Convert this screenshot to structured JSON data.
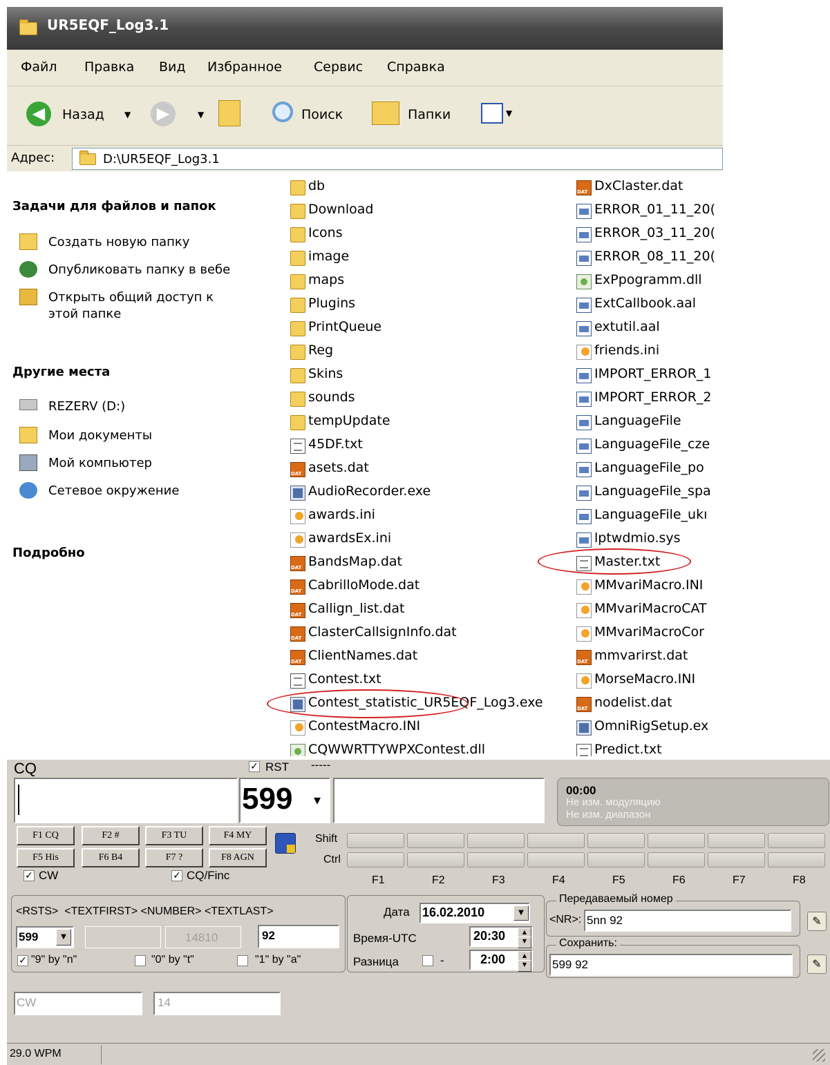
{
  "explorer": {
    "title": "UR5EQF_Log3.1",
    "menu": [
      "Файл",
      "Правка",
      "Вид",
      "Избранное",
      "Сервис",
      "Справка"
    ],
    "toolbar": {
      "back": "Назад",
      "search": "Поиск",
      "folders": "Папки"
    },
    "address": {
      "label": "Адрес:",
      "path": "D:\\UR5EQF_Log3.1"
    },
    "tasks": {
      "heading": "Задачи для файлов и папок",
      "items": [
        "Создать новую папку",
        "Опубликовать папку в вебе",
        "Открыть общий доступ к",
        "этой папке"
      ]
    },
    "places": {
      "heading": "Другие места",
      "items": [
        "REZERV (D:)",
        "Мои документы",
        "Мой компьютер",
        "Сетевое окружение"
      ]
    },
    "details": {
      "heading": "Подробно"
    },
    "files_col1": [
      {
        "name": "db",
        "type": "folder"
      },
      {
        "name": "Download",
        "type": "folder"
      },
      {
        "name": "Icons",
        "type": "folder"
      },
      {
        "name": "image",
        "type": "folder"
      },
      {
        "name": "maps",
        "type": "folder"
      },
      {
        "name": "Plugins",
        "type": "folder"
      },
      {
        "name": "PrintQueue",
        "type": "folder"
      },
      {
        "name": "Reg",
        "type": "folder"
      },
      {
        "name": "Skins",
        "type": "folder"
      },
      {
        "name": "sounds",
        "type": "folder"
      },
      {
        "name": "tempUpdate",
        "type": "folder"
      },
      {
        "name": "45DF.txt",
        "type": "txt"
      },
      {
        "name": "asets.dat",
        "type": "dat"
      },
      {
        "name": "AudioRecorder.exe",
        "type": "exe"
      },
      {
        "name": "awards.ini",
        "type": "ini"
      },
      {
        "name": "awardsEx.ini",
        "type": "ini"
      },
      {
        "name": "BandsMap.dat",
        "type": "dat"
      },
      {
        "name": "CabrilloMode.dat",
        "type": "dat"
      },
      {
        "name": "Callign_list.dat",
        "type": "dat"
      },
      {
        "name": "ClasterCallsignInfo.dat",
        "type": "dat"
      },
      {
        "name": "ClientNames.dat",
        "type": "dat"
      },
      {
        "name": "Contest.txt",
        "type": "txt"
      },
      {
        "name": "Contest_statistic_UR5EQF_Log3.exe",
        "type": "exe"
      },
      {
        "name": "ContestMacro.INI",
        "type": "ini"
      },
      {
        "name": "CQWWRTTYWPXContest.dll",
        "type": "dll"
      }
    ],
    "files_col2": [
      {
        "name": "DxClaster.dat",
        "type": "dat"
      },
      {
        "name": "ERROR_01_11_20(",
        "type": "sys"
      },
      {
        "name": "ERROR_03_11_20(",
        "type": "sys"
      },
      {
        "name": "ERROR_08_11_20(",
        "type": "sys"
      },
      {
        "name": "ExPpogramm.dll",
        "type": "dll"
      },
      {
        "name": "ExtCallbook.aal",
        "type": "sys"
      },
      {
        "name": "extutil.aal",
        "type": "sys"
      },
      {
        "name": "friends.ini",
        "type": "ini"
      },
      {
        "name": "IMPORT_ERROR_1",
        "type": "sys"
      },
      {
        "name": "IMPORT_ERROR_2",
        "type": "sys"
      },
      {
        "name": "LanguageFile",
        "type": "sys"
      },
      {
        "name": "LanguageFile_cze",
        "type": "sys"
      },
      {
        "name": "LanguageFile_po",
        "type": "sys"
      },
      {
        "name": "LanguageFile_spa",
        "type": "sys"
      },
      {
        "name": "LanguageFile_ukı",
        "type": "sys"
      },
      {
        "name": "lptwdmio.sys",
        "type": "sys"
      },
      {
        "name": "Master.txt",
        "type": "txt"
      },
      {
        "name": "MMvariMacro.INI",
        "type": "ini"
      },
      {
        "name": "MMvariMacroCAT",
        "type": "ini"
      },
      {
        "name": "MMvariMacroCor",
        "type": "ini"
      },
      {
        "name": "mmvarirst.dat",
        "type": "dat"
      },
      {
        "name": "MorseMacro.INI",
        "type": "ini"
      },
      {
        "name": "nodelist.dat",
        "type": "dat"
      },
      {
        "name": "OmniRigSetup.ex",
        "type": "exe"
      },
      {
        "name": "Predict.txt",
        "type": "txt"
      }
    ],
    "highlight_color": "#d42020"
  },
  "logger": {
    "mode_label": "CQ",
    "rst_label": "RST",
    "rst_dashes": "-----",
    "rst_value": "599",
    "clock": "00:00",
    "status1": "Не изм. модуляцию",
    "status2": "Не изм. диапазон",
    "fkeys_row1": [
      "F1 CQ",
      "F2 #",
      "F3 TU",
      "F4 MY"
    ],
    "fkeys_row2": [
      "F5 His",
      "F6 B4",
      "F7 ?",
      "F8 AGN"
    ],
    "shift_label": "Shift",
    "ctrl_label": "Ctrl",
    "f_labels": [
      "F1",
      "F2",
      "F3",
      "F4",
      "F5",
      "F6",
      "F7",
      "F8"
    ],
    "cw_check": "CW",
    "cq_check": "CQ/Finc",
    "tags_header": "<RSTS>  <TEXTFIRST> <NUMBER> <TEXTLAST>",
    "rsts_value": "599",
    "number_value": "14810",
    "textlast_value": "92",
    "opt1": "\"9\" by \"n\"",
    "opt2": "\"0\" by \"t\"",
    "opt3": "\"1\" by \"a\"",
    "date_label": "Дата",
    "date_value": "16.02.2010",
    "time_label": "Время-UTC",
    "time_value": "20:30",
    "diff_label": "Разница",
    "diff_minus": "-",
    "diff_value": "2:00",
    "sent_group": "Передаваемый номер",
    "nr_label": "<NR>:",
    "nr_value": "5nn 92",
    "save_group": "Сохранить:",
    "save_value": "599 92",
    "mode_field": "CW",
    "band_field": "14",
    "status_wpm": "29.0 WPM"
  }
}
